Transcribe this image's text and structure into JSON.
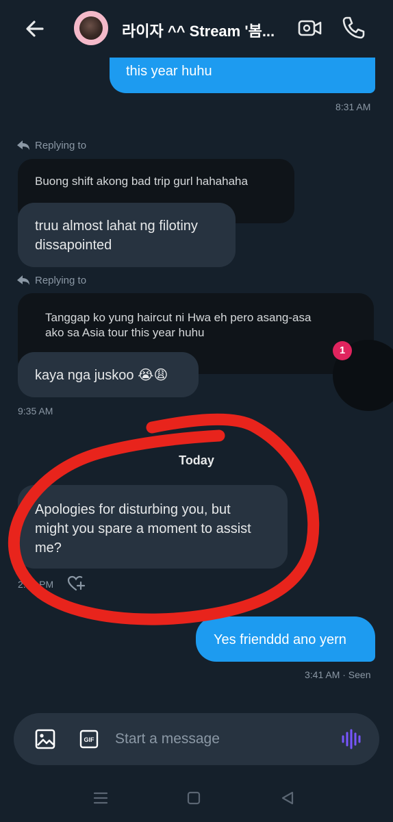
{
  "header": {
    "title": "라이자 ^^ Stream '봄...",
    "back_icon": "arrow-left-icon",
    "video_icon": "video-call-icon",
    "call_icon": "phone-icon"
  },
  "messages": {
    "out_1": {
      "text": "this year huhu",
      "time": "8:31 AM"
    },
    "reply_1": {
      "label": "Replying to",
      "quote": "Buong shift akong bad trip gurl hahahaha",
      "text_line1": "truu almost lahat ng filotiny",
      "text_line2": "dissapointed"
    },
    "reply_2": {
      "label": "Replying to",
      "quote_line1": "Tanggap ko yung  haircut ni Hwa eh pero asang-asa",
      "quote_line2": "ako sa Asia tour this year huhu",
      "text": "kaya nga juskoo 😭😩",
      "time": "9:35 AM"
    },
    "divider": "Today",
    "in_today": {
      "line1": "Apologies for disturbing you, but",
      "line2": "might you spare a moment to assist",
      "line3": "me?",
      "time": "2:45 PM"
    },
    "out_today": {
      "text": "Yes frienddd ano yern",
      "meta": "3:41 AM · Seen"
    }
  },
  "badge": {
    "count": "1"
  },
  "composer": {
    "placeholder": "Start a message",
    "gif_label": "GIF"
  },
  "colors": {
    "background": "#15202b",
    "outgoing_bubble": "#1d9bf0",
    "incoming_bubble": "#273340",
    "quote_bubble": "#0f1419",
    "annotation_red": "#e8241c",
    "voice_accent": "#7856ff"
  }
}
